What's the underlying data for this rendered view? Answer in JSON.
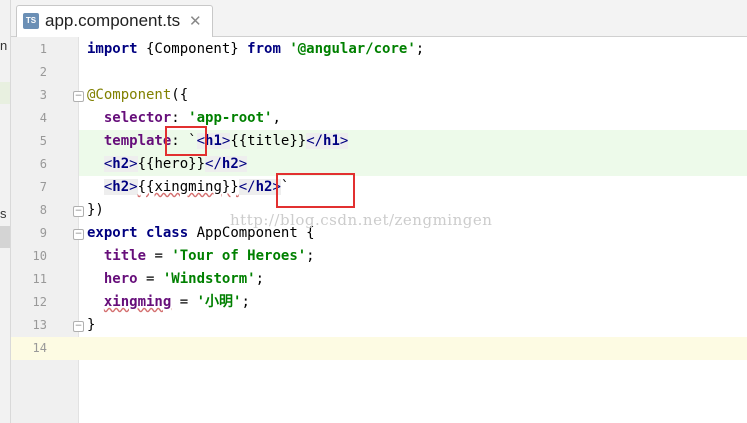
{
  "side_panel": {
    "fragments": [
      "n",
      "s"
    ]
  },
  "tab": {
    "title": "app.component.ts",
    "icon_label": "TS",
    "close_glyph": "✕"
  },
  "line_numbers": [
    "1",
    "2",
    "3",
    "4",
    "5",
    "6",
    "7",
    "8",
    "9",
    "10",
    "11",
    "12",
    "13",
    "14"
  ],
  "fold_markers": {
    "open": "−",
    "close": "−"
  },
  "code": {
    "l1": {
      "kw_import": "import",
      "brace_open": " {Component} ",
      "kw_from": "from",
      "sp": " ",
      "module": "'@angular/core'",
      "semi": ";"
    },
    "l3": {
      "decorator": "@Component",
      "rest": "({"
    },
    "l4": {
      "indent": "  ",
      "key": "selector",
      "colon": ": ",
      "value": "'app-root'",
      "comma": ","
    },
    "l5": {
      "indent": "  ",
      "key": "template",
      "colon": ": `",
      "lt": "<",
      "tag_open": "h1",
      "gt": ">",
      "text": "{{title}}",
      "lt2": "</",
      "tag_close": "h1",
      "gt2": ">"
    },
    "l6": {
      "indent": "  ",
      "lt": "<",
      "tag_open": "h2",
      "gt": ">",
      "text": "{{hero}}",
      "lt2": "</",
      "tag_close": "h2",
      "gt2": ">"
    },
    "l7": {
      "indent": "  ",
      "lt": "<",
      "tag_open": "h2",
      "gt": ">",
      "text": "{{xingming}}",
      "lt2": "</",
      "tag_close": "h2",
      "gt2": ">",
      "backtick": "`"
    },
    "l8": {
      "text": "})"
    },
    "l9": {
      "kw_export": "export",
      "kw_class": "class",
      "rest": " AppComponent {"
    },
    "l10": {
      "indent": "  ",
      "key": "title",
      "eq": " = ",
      "value": "'Tour of Heroes'",
      "semi": ";"
    },
    "l11": {
      "indent": "  ",
      "key": "hero",
      "eq": " = ",
      "value": "'Windstorm'",
      "semi": ";"
    },
    "l12": {
      "indent": "  ",
      "key": "xingming",
      "eq": " = ",
      "q1": "'",
      "value": "小明",
      "q2": "'",
      "semi": ";"
    },
    "l13": {
      "text": "}"
    }
  },
  "watermark": "http://blog.csdn.net/zengmingen",
  "colors": {
    "keyword": "#000080",
    "string": "#008000",
    "property": "#660e7a",
    "decorator": "#808000",
    "annotation": "#e23030",
    "template_highlight": "#edfaea",
    "caret_line": "#fdfbe3"
  }
}
